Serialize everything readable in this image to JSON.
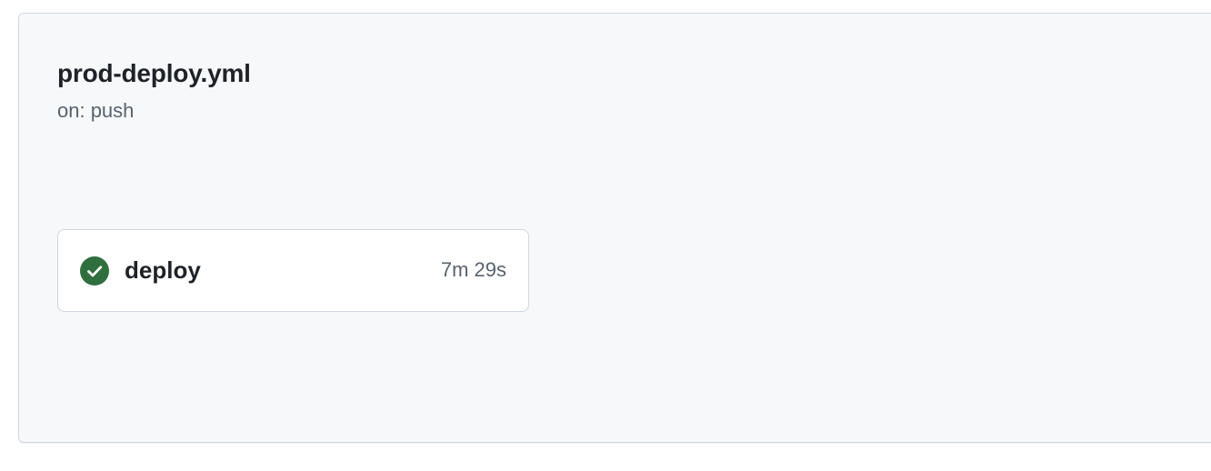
{
  "workflow": {
    "title": "prod-deploy.yml",
    "trigger": "on: push"
  },
  "job": {
    "name": "deploy",
    "duration": "7m 29s",
    "status": "success",
    "status_icon": "check-circle-fill-icon",
    "status_color": "#2f6f3e"
  }
}
